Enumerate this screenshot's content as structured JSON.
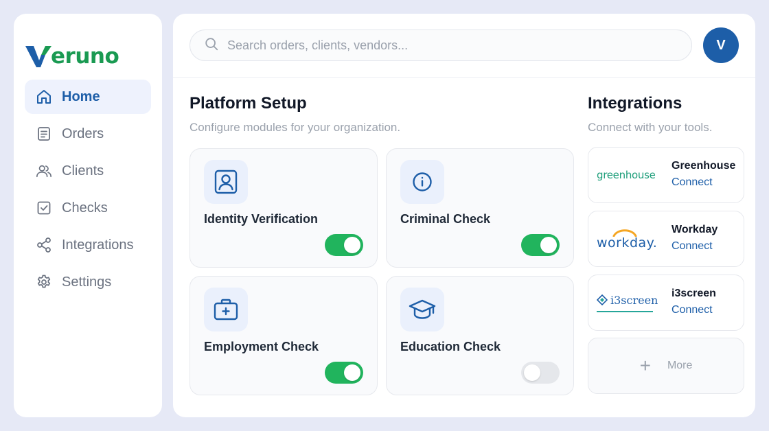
{
  "brand": {
    "name": "eruno",
    "initial": "V",
    "primary": "#1d5ea8",
    "accent": "#1a9a52"
  },
  "nav": {
    "items": [
      {
        "label": "Home",
        "icon": "home-icon",
        "active": true
      },
      {
        "label": "Orders",
        "icon": "document-icon"
      },
      {
        "label": "Clients",
        "icon": "users-icon"
      },
      {
        "label": "Checks",
        "icon": "checkbox-icon"
      },
      {
        "label": "Integrations",
        "icon": "share-icon"
      },
      {
        "label": "Settings",
        "icon": "gear-icon"
      }
    ]
  },
  "search": {
    "placeholder": "Search orders, clients, vendors..."
  },
  "user": {
    "avatar_initial": "V"
  },
  "platform": {
    "title": "Platform Setup",
    "subtitle": "Configure modules for your organization.",
    "modules": [
      {
        "title": "Identity Verification",
        "icon": "id-card-icon",
        "enabled": true
      },
      {
        "title": "Criminal Check",
        "icon": "info-icon",
        "enabled": true
      },
      {
        "title": "Employment Check",
        "icon": "briefcase-icon",
        "enabled": true
      },
      {
        "title": "Education Check",
        "icon": "graduation-cap-icon",
        "enabled": false
      }
    ]
  },
  "integrations": {
    "title": "Integrations",
    "subtitle": "Connect with your tools.",
    "items": [
      {
        "name": "Greenhouse",
        "action": "Connect",
        "logo_text": "greenhouse"
      },
      {
        "name": "Workday",
        "action": "Connect",
        "logo_text": "workday."
      },
      {
        "name": "i3screen",
        "action": "Connect",
        "logo_text": "i3screen"
      }
    ],
    "more": {
      "label": "More",
      "icon": "plus-icon"
    }
  },
  "colors": {
    "toggle_on": "#21b45d",
    "toggle_off": "#e5e7eb",
    "link": "#1d5ea8"
  }
}
